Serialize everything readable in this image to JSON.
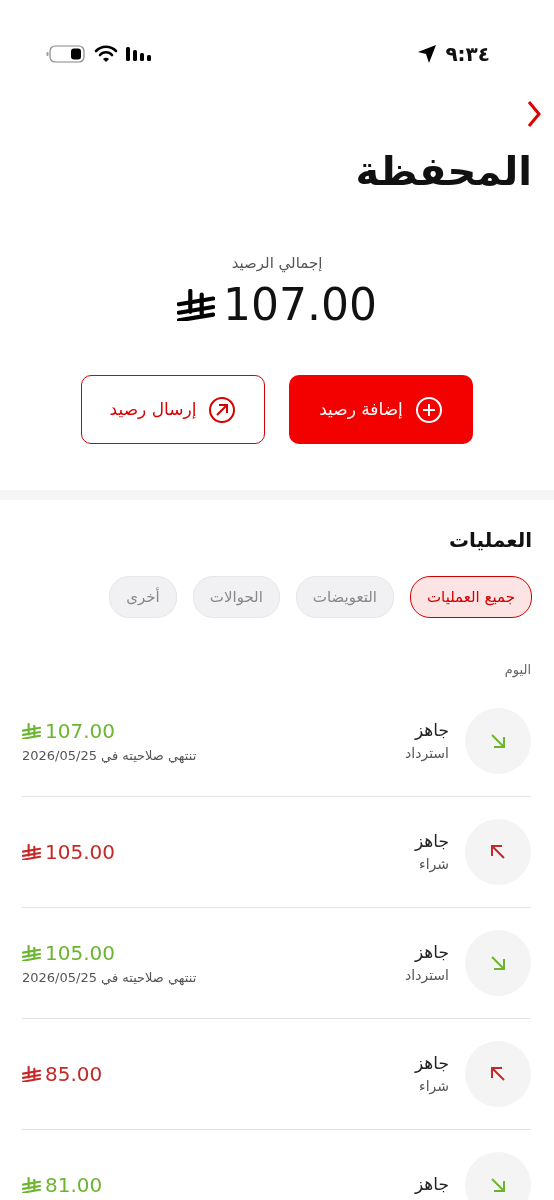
{
  "status_bar": {
    "time": "٩:٣٤"
  },
  "header": {
    "title": "المحفظة"
  },
  "balance": {
    "label": "إجمالي الرصيد",
    "amount": "107.00"
  },
  "actions": [
    {
      "label": "إضافة رصيد",
      "kind": "add"
    },
    {
      "label": "إرسال رصيد",
      "kind": "send"
    }
  ],
  "transactions_section": {
    "title": "العمليات",
    "filters": [
      {
        "label": "جميع العمليات",
        "selected": true
      },
      {
        "label": "التعويضات",
        "selected": false
      },
      {
        "label": "الحوالات",
        "selected": false
      },
      {
        "label": "أخرى",
        "selected": false
      }
    ],
    "group_label": "اليوم",
    "rows": [
      {
        "kind": "refund",
        "title": "جاهز",
        "subtitle": "استرداد",
        "amount": "107.00",
        "note": "تنتهي صلاحيته في 2026/05/25"
      },
      {
        "kind": "purchase",
        "title": "جاهز",
        "subtitle": "شراء",
        "amount": "105.00"
      },
      {
        "kind": "refund",
        "title": "جاهز",
        "subtitle": "استرداد",
        "amount": "105.00",
        "note": "تنتهي صلاحيته في 2026/05/25"
      },
      {
        "kind": "purchase",
        "title": "جاهز",
        "subtitle": "شراء",
        "amount": "85.00"
      },
      {
        "kind": "refund",
        "title": "جاهز",
        "amount": "81.00"
      }
    ]
  }
}
